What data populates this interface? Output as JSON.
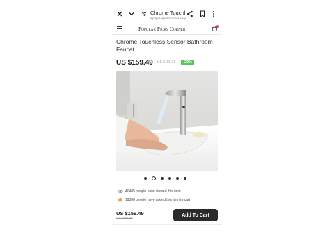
{
  "browser": {
    "tab_title": "Chrome Touchl...",
    "url": "wpopularpickscorner.shop"
  },
  "site": {
    "brand": "Popular Picks Corner"
  },
  "product": {
    "title": "Chrome Touchless Sensor Bathroom Faucet",
    "price": "US $159.49",
    "old_price": "US $199.36",
    "discount": "-20%",
    "carousel": {
      "count": 6,
      "active_index": 1
    }
  },
  "social_proof": {
    "viewed_text": "40485 people have viewed this item",
    "added_text": "19380 people have added this item to cart"
  },
  "bottom_bar": {
    "price": "US $159.49",
    "old_price": "US $199.36",
    "add_to_cart_label": "Add To Cart"
  },
  "colors": {
    "discount_badge": "#5cc25c",
    "cart_button": "#2a2a2a",
    "cart_notification": "#e23d3d"
  }
}
